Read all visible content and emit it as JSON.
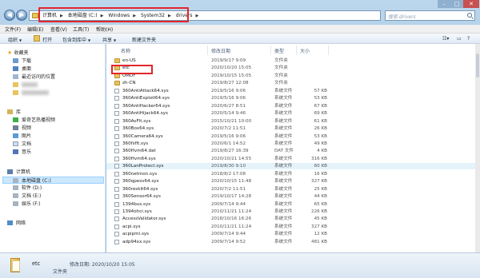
{
  "titlebar": {
    "back_glyph": "◀",
    "forward_glyph": "▶",
    "breadcrumbs": [
      "计算机",
      "本地磁盘 (C:)",
      "Windows",
      "System32",
      "drivers"
    ],
    "search_placeholder": "搜索 drivers",
    "refresh_glyph": "⟳",
    "min_glyph": "–",
    "max_glyph": "□",
    "close_glyph": "✕"
  },
  "menubar": [
    "文件(F)",
    "编辑(E)",
    "查看(V)",
    "工具(T)",
    "帮助(H)"
  ],
  "toolbar": {
    "organize": "组织",
    "open": "打开",
    "include_in_library": "包含到库中",
    "share": "共享",
    "new_folder": "新建文件夹"
  },
  "nav": {
    "favorites": "收藏夹",
    "downloads": "下载",
    "desktop": "桌面",
    "recent": "最近访问的位置",
    "libraries": "库",
    "iqiyi": "爱奇艺热播视频",
    "videos": "视频",
    "pictures": "图片",
    "documents": "文档",
    "music": "音乐",
    "computer": "计算机",
    "drive_c": "本地磁盘 (C:)",
    "drive_d": "软件 (D:)",
    "drive_e": "文档 (E:)",
    "drive_f": "娱乐 (F:)",
    "network": "网络"
  },
  "columns": {
    "name": "名称",
    "date": "修改日期",
    "type": "类型",
    "size": "大小"
  },
  "files": [
    {
      "name": "en-US",
      "date": "2019/9/17 9:09",
      "type": "文件夹",
      "size": ""
    },
    {
      "name": "etc",
      "date": "2020/10/20 15:05",
      "type": "文件夹",
      "size": ""
    },
    {
      "name": "UMDF",
      "date": "2019/10/15 15:05",
      "type": "文件夹",
      "size": ""
    },
    {
      "name": "zh-CN",
      "date": "2019/8/27 12:08",
      "type": "文件夹",
      "size": ""
    },
    {
      "name": "360AntiAttack64.sys",
      "date": "2019/5/16 9:06",
      "type": "系统文件",
      "size": "57 KB"
    },
    {
      "name": "360AntiExploit64.sys",
      "date": "2019/5/16 9:06",
      "type": "系统文件",
      "size": "53 KB"
    },
    {
      "name": "360AntiHacker64.sys",
      "date": "2020/6/27 8:51",
      "type": "系统文件",
      "size": "67 KB"
    },
    {
      "name": "360AntiHijack64.sys",
      "date": "2020/5/14 9:46",
      "type": "系统文件",
      "size": "69 KB"
    },
    {
      "name": "360AvFlt.sys",
      "date": "2015/10/21 10:00",
      "type": "系统文件",
      "size": "61 KB"
    },
    {
      "name": "360Box64.sys",
      "date": "2020/7/2 11:51",
      "type": "系统文件",
      "size": "26 KB"
    },
    {
      "name": "360Camera64.sys",
      "date": "2019/5/16 9:06",
      "type": "系统文件",
      "size": "53 KB"
    },
    {
      "name": "360fsflt.sys",
      "date": "2020/6/1 14:52",
      "type": "系统文件",
      "size": "49 KB"
    },
    {
      "name": "360Hvm64.dat",
      "date": "2019/8/27 16:39",
      "type": "DAT 文件",
      "size": "4 KB"
    },
    {
      "name": "360Hvm64.sys",
      "date": "2020/10/21 14:55",
      "type": "系统文件",
      "size": "316 KB"
    },
    {
      "name": "360LanProtect.sys",
      "date": "2019/8/30 9:10",
      "type": "系统文件",
      "size": "60 KB"
    },
    {
      "name": "360netmon.sys",
      "date": "2018/8/2 17:08",
      "type": "系统文件",
      "size": "16 KB"
    },
    {
      "name": "360qpesv64.sys",
      "date": "2020/10/15 11:48",
      "type": "系统文件",
      "size": "327 KB"
    },
    {
      "name": "360reskit64.sys",
      "date": "2020/7/2 11:51",
      "type": "系统文件",
      "size": "25 KB"
    },
    {
      "name": "360Sensor64.sys",
      "date": "2019/10/17 14:28",
      "type": "系统文件",
      "size": "44 KB"
    },
    {
      "name": "1394bus.sys",
      "date": "2009/7/14 9:44",
      "type": "系统文件",
      "size": "65 KB"
    },
    {
      "name": "1394ohci.sys",
      "date": "2010/11/21 11:24",
      "type": "系统文件",
      "size": "226 KB"
    },
    {
      "name": "AccessValidator.sys",
      "date": "2018/10/16 16:26",
      "type": "系统文件",
      "size": "45 KB"
    },
    {
      "name": "acpi.sys",
      "date": "2010/11/21 11:24",
      "type": "系统文件",
      "size": "327 KB"
    },
    {
      "name": "acpipmi.sys",
      "date": "2009/7/14 9:44",
      "type": "系统文件",
      "size": "12 KB"
    },
    {
      "name": "adp94xx.sys",
      "date": "2009/7/14 9:52",
      "type": "系统文件",
      "size": "481 KB"
    }
  ],
  "details": {
    "name": "etc",
    "date_label": "修改日期: 2020/10/20 15:05",
    "type": "文件夹"
  },
  "colors": {
    "highlight_red": "#e3262c",
    "folder_yellow": "#e9c45d",
    "frame_blue": "#a8c8e2"
  }
}
